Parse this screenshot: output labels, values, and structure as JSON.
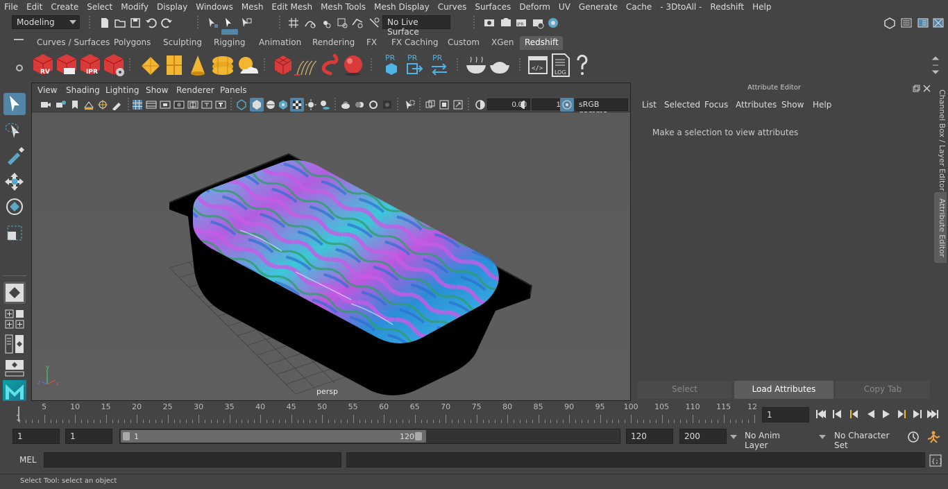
{
  "menubar": {
    "items": [
      "File",
      "Edit",
      "Create",
      "Select",
      "Modify",
      "Display",
      "Windows",
      "Mesh",
      "Edit Mesh",
      "Mesh Tools",
      "Mesh Display",
      "Curves",
      "Surfaces",
      "Deform",
      "UV",
      "Generate",
      "Cache",
      "- 3DtoAll -",
      "Redshift",
      "Help"
    ]
  },
  "statusline": {
    "mode": "Modeling",
    "live_surface": "No Live Surface"
  },
  "shelf": {
    "tabs": [
      "Curves / Surfaces",
      "Polygons",
      "Sculpting",
      "Rigging",
      "Animation",
      "Rendering",
      "FX",
      "FX Caching",
      "Custom",
      "XGen",
      "Redshift"
    ],
    "active_tab": "Redshift",
    "icon_labels": {
      "rv": "RV",
      "ipr": "IPR",
      "pr1": "PR",
      "pr2": "PR",
      "pr3": "PR",
      "log": "LOG"
    }
  },
  "viewport": {
    "menu": [
      "View",
      "Shading",
      "Lighting",
      "Show",
      "Renderer",
      "Panels"
    ],
    "exposure": "0.00",
    "gamma": "1.00",
    "color_space": "sRGB gamma",
    "camera_label": "persp"
  },
  "attribute_editor": {
    "title": "Attribute Editor",
    "menu": [
      "List",
      "Selected",
      "Focus",
      "Attributes",
      "Show",
      "Help"
    ],
    "message": "Make a selection to view attributes",
    "buttons": {
      "select": "Select",
      "load": "Load Attributes",
      "copy": "Copy Tab"
    }
  },
  "side_tabs": {
    "channel_box": "Channel Box / Layer Editor",
    "attribute_editor": "Attribute Editor"
  },
  "timeslider": {
    "labels": [
      "5",
      "10",
      "15",
      "20",
      "25",
      "30",
      "35",
      "40",
      "45",
      "50",
      "55",
      "60",
      "65",
      "70",
      "75",
      "80",
      "85",
      "90",
      "95",
      "100",
      "105",
      "110",
      "115",
      "12"
    ],
    "start_label": "1",
    "current_frame": "1"
  },
  "range": {
    "start": "1",
    "playback_start": "1",
    "slider_start": "1",
    "slider_end": "120",
    "playback_end": "120",
    "end": "200",
    "anim_layer": "No Anim Layer",
    "character_set": "No Character Set"
  },
  "cmdline": {
    "language": "MEL"
  },
  "helpline": {
    "text": "Select Tool: select an object"
  },
  "colors": {
    "background": "#444444",
    "viewport_bg": "#5c5c5c",
    "active_button": "#5d5d5d",
    "highlight_blue": "#5285a6",
    "redshift_red": "#d93a3a"
  }
}
